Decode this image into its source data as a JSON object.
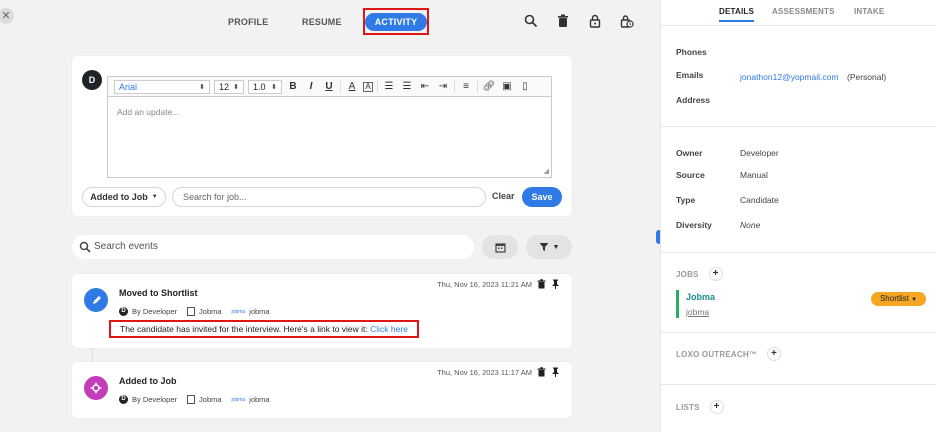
{
  "nav": {
    "close": "✕",
    "profile": "PROFILE",
    "resume": "RESUME",
    "activity": "ACTIVITY"
  },
  "composer": {
    "avatar": "D",
    "font": "Arial",
    "size": "12",
    "line_height": "1.0",
    "placeholder": "Add an update...",
    "added_to_job": "Added to Job",
    "job_search_placeholder": "Search for job...",
    "clear": "Clear",
    "save": "Save"
  },
  "events_search": {
    "placeholder": "Search events"
  },
  "events": [
    {
      "title": "Moved to Shortlist",
      "time": "Thu, Nov 16, 2023 11:21 AM",
      "by": "By Developer",
      "company": "Jobma",
      "job": "jobma",
      "note_text": "The candidate has invited for the interview. Here's a link to view it: ",
      "note_link": "Click here",
      "icon_color": "#2f7ae5"
    },
    {
      "title": "Added to Job",
      "time": "Thu, Nov 16, 2023 11:17 AM",
      "by": "By Developer",
      "company": "Jobma",
      "job": "jobma",
      "icon_color": "#c43cb8"
    }
  ],
  "right": {
    "tabs": {
      "details": "DETAILS",
      "assessments": "ASSESSMENTS",
      "intake": "INTAKE"
    },
    "contact": {
      "phones_label": "Phones",
      "emails_label": "Emails",
      "email": "jonathon12@yopmail.com",
      "email_type": "(Personal)",
      "address_label": "Address"
    },
    "info": {
      "owner_label": "Owner",
      "owner": "Developer",
      "source_label": "Source",
      "source": "Manual",
      "type_label": "Type",
      "type": "Candidate",
      "diversity_label": "Diversity",
      "diversity": "None"
    },
    "jobs": {
      "header": "JOBS",
      "name": "Jobma",
      "sub": "jobma",
      "status": "Shortlist"
    },
    "outreach": {
      "header": "LOXO OUTREACH™"
    },
    "lists": {
      "header": "LISTS"
    }
  },
  "colors": {
    "accent": "#2f7ae5",
    "highlight": "#e01515",
    "shortlist": "#f5a623",
    "job_bar": "#27ae60"
  }
}
